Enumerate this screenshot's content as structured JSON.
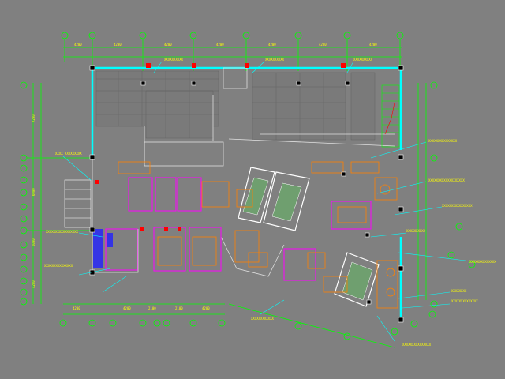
{
  "drawing": {
    "description_layer": "architectural floor plan, CAD model space",
    "colors": {
      "background": "#808080",
      "grid_bubble": "#00ff00",
      "dimension": "#00ff00",
      "exterior_wall": "#00ffff",
      "interior_wall": "#ffffff",
      "furniture": "#ff8000",
      "partition": "#ff00ff",
      "column_marker": "#ff0000",
      "leader_text": "#ffff00",
      "blue_zone": "#0000ff"
    },
    "top_dims": [
      "4200",
      "4200",
      "4200",
      "4200",
      "4200",
      "4200",
      "4200"
    ],
    "bottom_dims": [
      "4200",
      "4200",
      "2100",
      "2100",
      "4200",
      "4200"
    ],
    "left_dims": [
      "7200",
      "6000",
      "6000",
      "4200"
    ],
    "annotations": [
      "XXXXXXXXXX",
      "XXXXXXXXXX",
      "XXXXXXXXXX",
      "XXXX XXXXXXXXX",
      "XXXXXXXXXXXXXXX",
      "XXXXXXXXXXXXXXXXXXX",
      "XXXXXXXXXXXXXXXX",
      "XXXXXXXXXX",
      "XXXXXXXXXXXXXX",
      "XXXXXXXX",
      "XXXXXXXXXXXXXX",
      "XXXXXXXXXXXXXXXXX",
      "XXXXXXXXXXXXXXX",
      "XXXXXXXXXXXX",
      "XXXXXXXXXXXXXXX"
    ]
  }
}
